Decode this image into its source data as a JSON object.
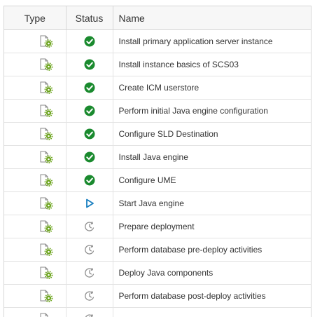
{
  "columns": {
    "type": "Type",
    "status": "Status",
    "name": "Name"
  },
  "colors": {
    "success": "#1a8a2e",
    "running": "#1a7fc0",
    "pending": "#8c8c8c",
    "gear": "#6aa31a"
  },
  "rows": [
    {
      "type_icon": "config-task-icon",
      "status": "completed",
      "name": "Install primary application server instance"
    },
    {
      "type_icon": "config-task-icon",
      "status": "completed",
      "name": "Install instance basics of SCS03"
    },
    {
      "type_icon": "config-task-icon",
      "status": "completed",
      "name": "Create ICM userstore"
    },
    {
      "type_icon": "config-task-icon",
      "status": "completed",
      "name": "Perform initial Java engine configuration"
    },
    {
      "type_icon": "config-task-icon",
      "status": "completed",
      "name": "Configure SLD Destination"
    },
    {
      "type_icon": "config-task-icon",
      "status": "completed",
      "name": "Install Java engine"
    },
    {
      "type_icon": "config-task-icon",
      "status": "completed",
      "name": "Configure UME"
    },
    {
      "type_icon": "config-task-icon",
      "status": "running",
      "name": "Start Java engine"
    },
    {
      "type_icon": "config-task-icon",
      "status": "pending",
      "name": "Prepare deployment"
    },
    {
      "type_icon": "config-task-icon",
      "status": "pending",
      "name": "Perform database pre-deploy activities"
    },
    {
      "type_icon": "config-task-icon",
      "status": "pending",
      "name": "Deploy Java components"
    },
    {
      "type_icon": "config-task-icon",
      "status": "pending",
      "name": "Perform database post-deploy activities"
    },
    {
      "type_icon": "config-task-icon",
      "status": "pending",
      "name": ""
    }
  ]
}
